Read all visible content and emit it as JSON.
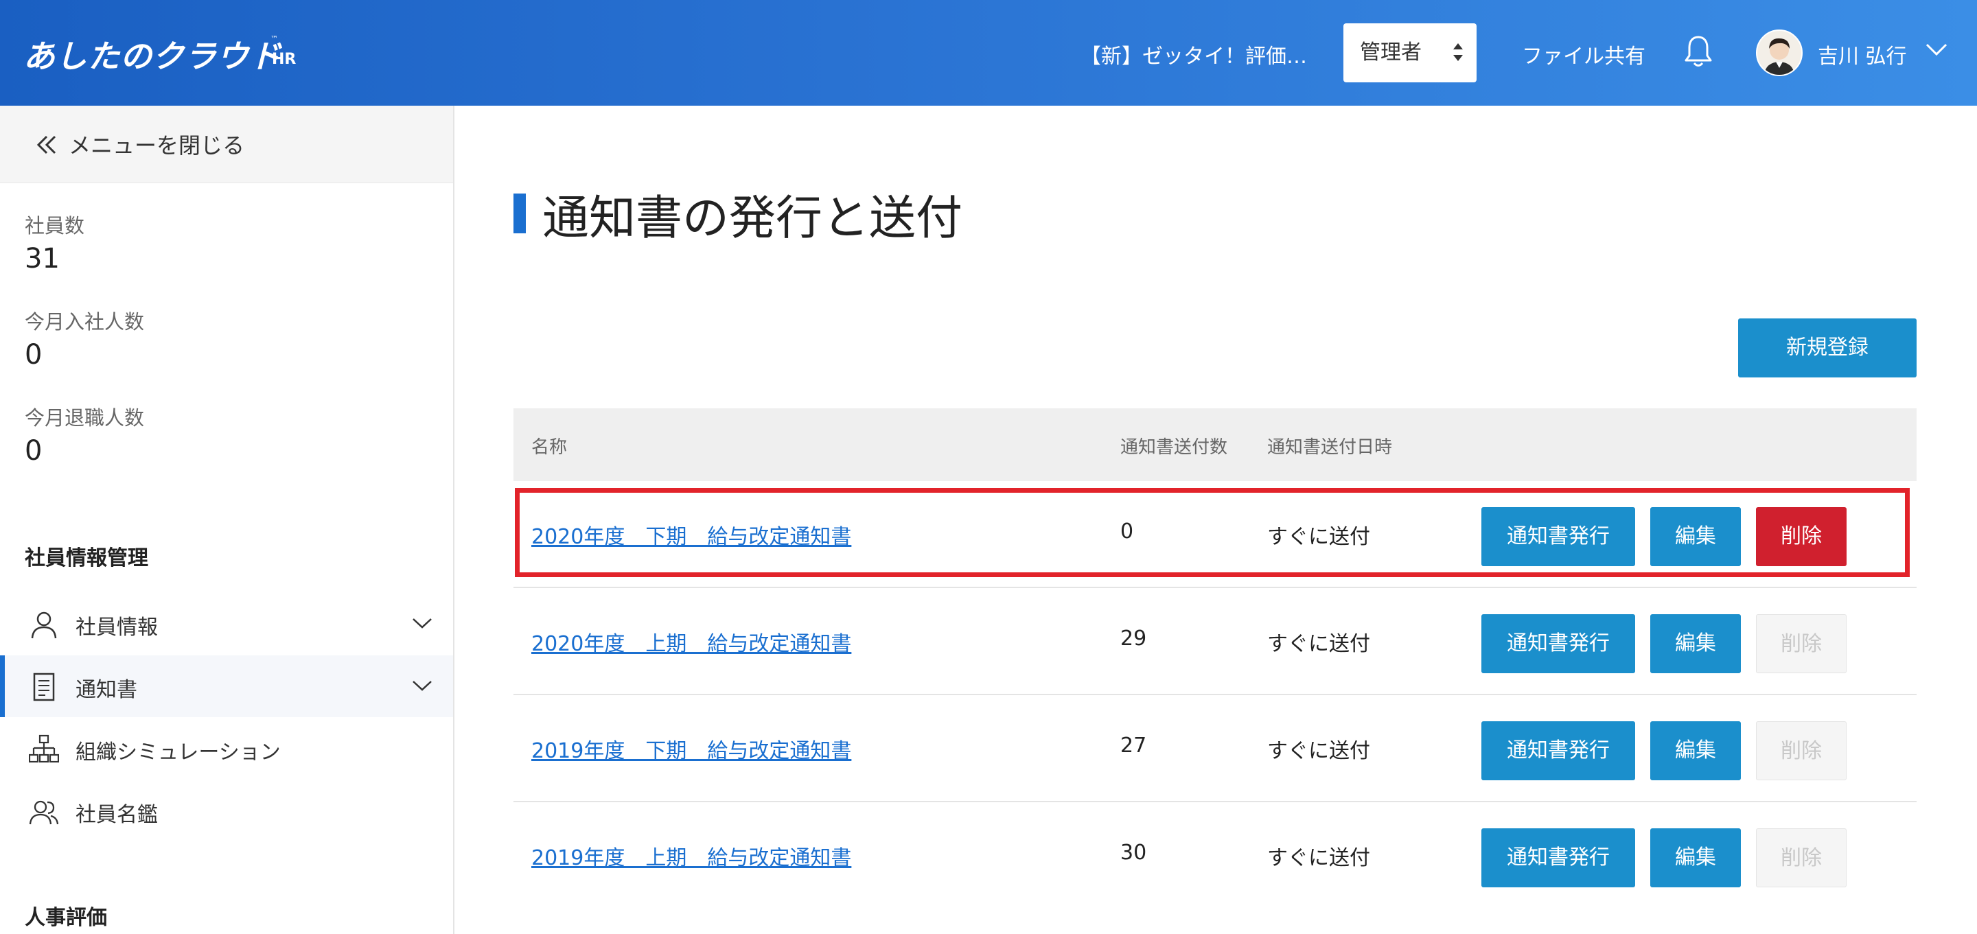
{
  "header": {
    "logo_text": "あしたのクラウド",
    "logo_tm": "™",
    "logo_suffix": "HR",
    "company_name": "【新】ゼッタイ！評価…",
    "role_select_value": "管理者",
    "file_share_label": "ファイル共有",
    "user_name": "吉川 弘行"
  },
  "sidebar": {
    "close_menu_label": "メニューを閉じる",
    "stats": [
      {
        "label": "社員数",
        "value": "31"
      },
      {
        "label": "今月入社人数",
        "value": "0"
      },
      {
        "label": "今月退職人数",
        "value": "0"
      }
    ],
    "section_employee": "社員情報管理",
    "items": [
      {
        "label": "社員情報",
        "icon": "person-icon",
        "expandable": true
      },
      {
        "label": "通知書",
        "icon": "document-icon",
        "expandable": true,
        "active": true
      },
      {
        "label": "組織シミュレーション",
        "icon": "org-chart-icon",
        "expandable": false
      },
      {
        "label": "社員名鑑",
        "icon": "people-icon",
        "expandable": false
      }
    ],
    "section_evaluation": "人事評価"
  },
  "main": {
    "page_title": "通知書の発行と送付",
    "new_button_label": "新規登録",
    "table": {
      "headers": {
        "name": "名称",
        "count": "通知書送付数",
        "datetime": "通知書送付日時"
      },
      "rows": [
        {
          "name": "2020年度　下期　給与改定通知書",
          "count": "0",
          "datetime": "すぐに送付",
          "delete_enabled": true
        },
        {
          "name": "2020年度　上期　給与改定通知書",
          "count": "29",
          "datetime": "すぐに送付",
          "delete_enabled": false
        },
        {
          "name": "2019年度　下期　給与改定通知書",
          "count": "27",
          "datetime": "すぐに送付",
          "delete_enabled": false
        },
        {
          "name": "2019年度　上期　給与改定通知書",
          "count": "30",
          "datetime": "すぐに送付",
          "delete_enabled": false
        }
      ],
      "issue_label": "通知書発行",
      "edit_label": "編集",
      "delete_label": "削除"
    }
  },
  "colors": {
    "header_start": "#1a5fc2",
    "header_end": "#3b8ee6",
    "primary_button": "#1b8fcc",
    "delete_button": "#d0202e",
    "highlight_border": "#e2232a",
    "link": "#1a6fd0"
  }
}
